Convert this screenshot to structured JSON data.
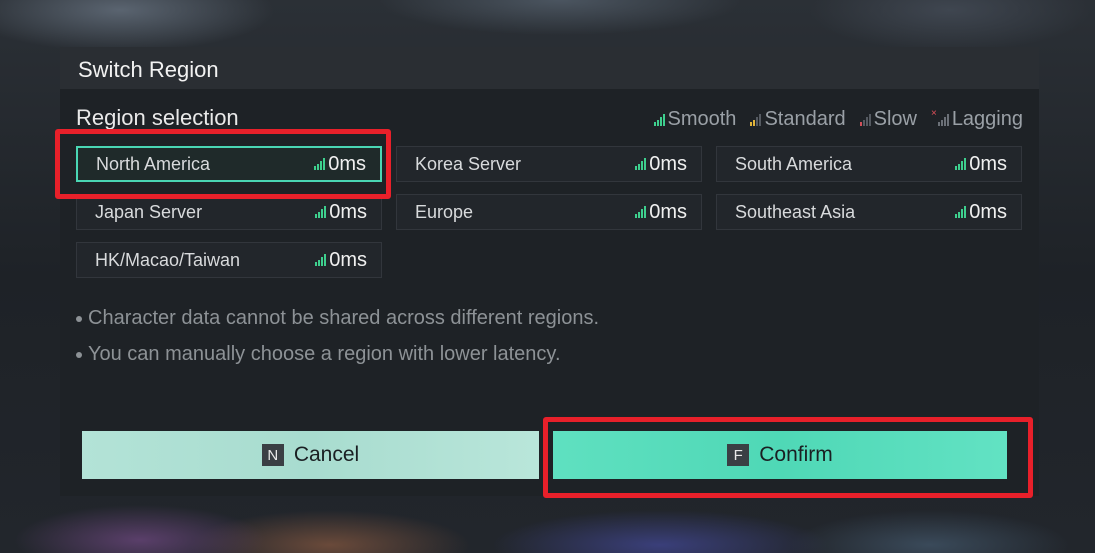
{
  "dialog": {
    "title": "Switch Region",
    "section_title": "Region selection"
  },
  "legend": [
    {
      "label": "Smooth",
      "status": "smooth",
      "color": "#3ecf8e"
    },
    {
      "label": "Standard",
      "status": "standard",
      "color": "#e1b43a"
    },
    {
      "label": "Slow",
      "status": "slow",
      "color": "#d0505a"
    },
    {
      "label": "Lagging",
      "status": "lagging",
      "color": "#e0505a"
    }
  ],
  "servers": [
    {
      "name": "North America",
      "ping": "0ms",
      "selected": true
    },
    {
      "name": "Korea Server",
      "ping": "0ms",
      "selected": false
    },
    {
      "name": "South America",
      "ping": "0ms",
      "selected": false
    },
    {
      "name": "Japan Server",
      "ping": "0ms",
      "selected": false
    },
    {
      "name": "Europe",
      "ping": "0ms",
      "selected": false
    },
    {
      "name": "Southeast Asia",
      "ping": "0ms",
      "selected": false
    },
    {
      "name": "HK/Macao/Taiwan",
      "ping": "0ms",
      "selected": false
    }
  ],
  "notes": [
    "Character data cannot be shared across different regions.",
    "You can manually choose a region with lower latency."
  ],
  "buttons": {
    "cancel": {
      "key": "N",
      "label": "Cancel"
    },
    "confirm": {
      "key": "F",
      "label": "Confirm"
    }
  },
  "colors": {
    "accent": "#4ad6b4",
    "highlight": "#e8202a"
  }
}
